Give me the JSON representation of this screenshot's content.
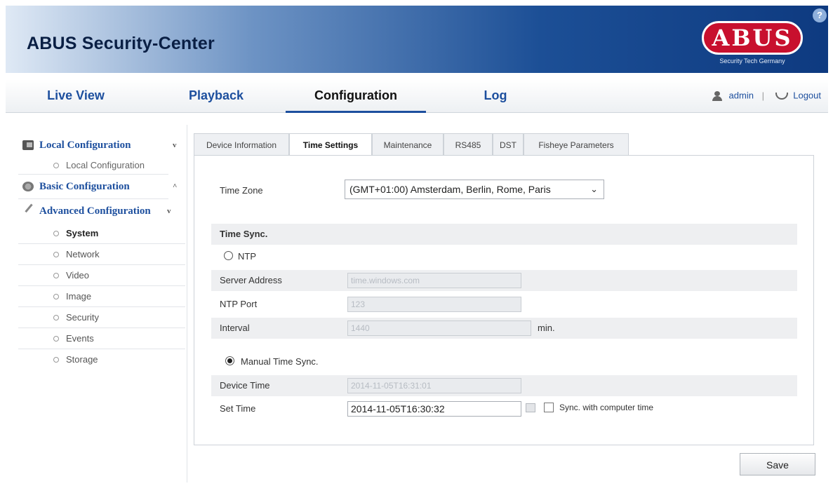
{
  "header": {
    "app_title": "ABUS Security-Center",
    "logo_text": "ABUS",
    "logo_subtitle": "Security Tech Germany"
  },
  "nav": {
    "tabs": [
      "Live View",
      "Playback",
      "Configuration",
      "Log"
    ],
    "active": "Configuration",
    "user": "admin",
    "separator": "|",
    "logout": "Logout"
  },
  "sidebar": {
    "local": {
      "title": "Local Configuration",
      "chevron": "v",
      "items": [
        "Local Configuration"
      ]
    },
    "basic": {
      "title": "Basic Configuration",
      "chevron": "^"
    },
    "advanced": {
      "title": "Advanced Configuration",
      "chevron": "v",
      "items": [
        "System",
        "Network",
        "Video",
        "Image",
        "Security",
        "Events",
        "Storage"
      ],
      "active_item": "System"
    }
  },
  "tabs": {
    "items": [
      "Device Information",
      "Time Settings",
      "Maintenance",
      "RS485",
      "DST",
      "Fisheye Parameters"
    ],
    "active": "Time Settings"
  },
  "form": {
    "time_zone_label": "Time Zone",
    "time_zone_value": "(GMT+01:00) Amsterdam, Berlin, Rome, Paris",
    "time_sync_heading": "Time Sync.",
    "ntp_label": "NTP",
    "ntp_selected": false,
    "server_address_label": "Server Address",
    "server_address_value": "time.windows.com",
    "ntp_port_label": "NTP Port",
    "ntp_port_value": "123",
    "interval_label": "Interval",
    "interval_value": "1440",
    "interval_unit": "min.",
    "manual_label": "Manual Time Sync.",
    "manual_selected": true,
    "device_time_label": "Device Time",
    "device_time_value": "2014-11-05T16:31:01",
    "set_time_label": "Set Time",
    "set_time_value": "2014-11-05T16:30:32",
    "sync_computer_label": "Sync. with computer time",
    "sync_computer_checked": false
  },
  "actions": {
    "save": "Save"
  },
  "colors": {
    "brand_blue": "#1d4f9e",
    "logo_red": "#c8102e",
    "header_dark": "#0e3a80"
  }
}
